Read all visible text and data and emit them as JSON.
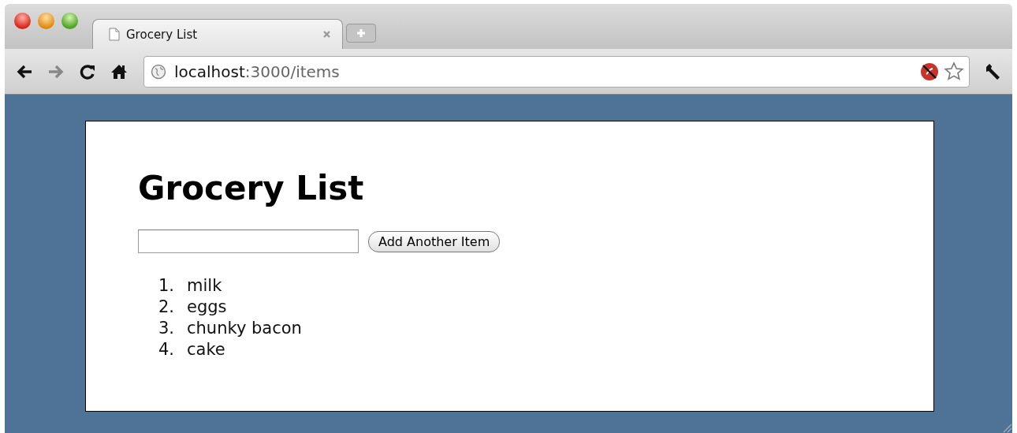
{
  "tabs": [
    {
      "title": "Grocery List",
      "selected": true
    }
  ],
  "toolbar": {
    "back_disabled": false,
    "forward_disabled": true,
    "url_host": "localhost",
    "url_path": ":3000/items"
  },
  "page": {
    "heading": "Grocery List",
    "button": "Add Another Item",
    "items": [
      {
        "number": "1.",
        "text": "milk"
      },
      {
        "number": "2.",
        "text": "eggs"
      },
      {
        "number": "3.",
        "text": "chunky bacon"
      },
      {
        "number": "4.",
        "text": "cake"
      }
    ]
  }
}
